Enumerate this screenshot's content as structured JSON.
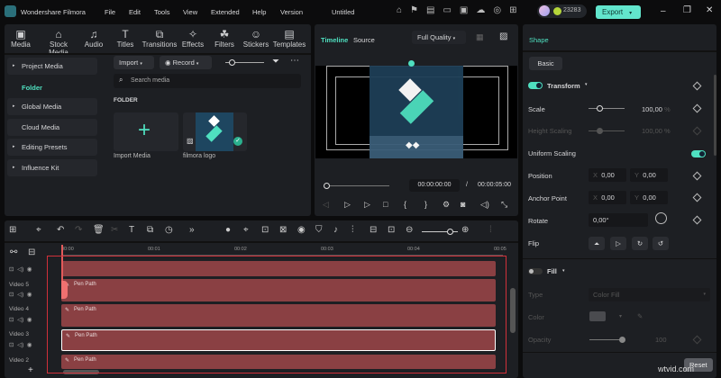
{
  "app": {
    "title": "Wondershare Filmora",
    "project": "Untitled",
    "credits": "23283",
    "export_label": "Export"
  },
  "menu": [
    "File",
    "Edit",
    "Tools",
    "View",
    "Extended",
    "Help",
    "Version"
  ],
  "toolbar_tabs": [
    {
      "label": "Media",
      "icon": "media-icon",
      "active": true
    },
    {
      "label": "Stock Media",
      "icon": "stock-media-icon"
    },
    {
      "label": "Audio",
      "icon": "audio-icon"
    },
    {
      "label": "Titles",
      "icon": "titles-icon"
    },
    {
      "label": "Transitions",
      "icon": "transitions-icon"
    },
    {
      "label": "Effects",
      "icon": "effects-icon"
    },
    {
      "label": "Filters",
      "icon": "filters-icon"
    },
    {
      "label": "Stickers",
      "icon": "stickers-icon"
    },
    {
      "label": "Templates",
      "icon": "templates-icon"
    }
  ],
  "sidebar": {
    "items": [
      {
        "label": "Project Media"
      },
      {
        "label": "Folder",
        "active": true
      },
      {
        "label": "Global Media"
      },
      {
        "label": "Cloud Media"
      },
      {
        "label": "Editing Presets"
      },
      {
        "label": "Influence Kit"
      }
    ]
  },
  "media": {
    "import_label": "Import",
    "record_label": "Record",
    "search_placeholder": "Search media",
    "section": "FOLDER",
    "items": [
      {
        "label": "Import Media"
      },
      {
        "label": "filmora logo"
      }
    ]
  },
  "preview": {
    "tabs": [
      "Timeline",
      "Source"
    ],
    "quality": "Full Quality",
    "current_time": "00:00:00:00",
    "separator": "/",
    "total_time": "00:00:05:00"
  },
  "inspector": {
    "title": "Shape",
    "tab": "Basic",
    "transform_label": "Transform",
    "scale_label": "Scale",
    "scale_value": "100,00",
    "pct": "%",
    "height_scaling_label": "Height Scaling",
    "height_scaling_value": "100,00",
    "uniform_scaling_label": "Uniform Scaling",
    "position_label": "Position",
    "anchor_label": "Anchor Point",
    "x": "X",
    "y": "Y",
    "pos_x": "0,00",
    "pos_y": "0,00",
    "anchor_x": "0,00",
    "anchor_y": "0,00",
    "rotate_label": "Rotate",
    "rotate_value": "0,00°",
    "flip_label": "Flip",
    "fill_label": "Fill",
    "type_label": "Type",
    "type_value": "Color Fill",
    "color_label": "Color",
    "opacity_label": "Opacity",
    "opacity_value": "100",
    "reset_label": "Reset",
    "scale_fraction": 0.3,
    "opacity_fraction": 1.0
  },
  "timeline": {
    "ruler": [
      "00:00",
      "00:01",
      "00:02",
      "00:03",
      "00:04",
      "00:05"
    ],
    "tracks": [
      {
        "label": ""
      },
      {
        "label": "Video 5",
        "clip": "Pen Path"
      },
      {
        "label": "Video 4",
        "clip": "Pen Path"
      },
      {
        "label": "Video 3",
        "clip": "Pen Path",
        "selected": true
      },
      {
        "label": "Video 2",
        "clip": "Pen Path"
      }
    ]
  },
  "watermark": "wtvid.com",
  "colors": {
    "accent": "#4fe0c0",
    "export": "#62e5cc",
    "clip": "#8a4043",
    "highlight": "#d0303a"
  }
}
